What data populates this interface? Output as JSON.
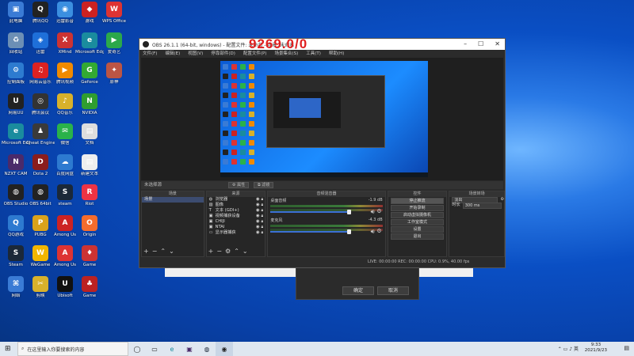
{
  "overlay_number": "9269.0/0",
  "desktop_icons": [
    {
      "label": "此电脑",
      "color": "#3a7bd5",
      "glyph": "▣"
    },
    {
      "label": "腾讯QQ",
      "color": "#222",
      "glyph": "Q"
    },
    {
      "label": "迅雷影音",
      "color": "#3b8fe0",
      "glyph": "◉"
    },
    {
      "label": "游戏",
      "color": "#c22",
      "glyph": "◆"
    },
    {
      "label": "WPS Office",
      "color": "#d33",
      "glyph": "W"
    },
    {
      "label": "回收站",
      "color": "#6c8fb5",
      "glyph": "♻"
    },
    {
      "label": "迅雷",
      "color": "#1e6fd9",
      "glyph": "◈"
    },
    {
      "label": "XMind",
      "color": "#c33",
      "glyph": "X"
    },
    {
      "label": "Microsoft Edge",
      "color": "#1a8c9e",
      "glyph": "e"
    },
    {
      "label": "爱奇艺",
      "color": "#2ba84a",
      "glyph": "▶"
    },
    {
      "label": "控制面板",
      "color": "#2d7bd0",
      "glyph": "⚙"
    },
    {
      "label": "网易云音乐",
      "color": "#d22",
      "glyph": "♫"
    },
    {
      "label": "腾讯视频",
      "color": "#f08a00",
      "glyph": "▶"
    },
    {
      "label": "Geforce",
      "color": "#3a3",
      "glyph": "G"
    },
    {
      "label": "原神",
      "color": "#b54",
      "glyph": "✦"
    },
    {
      "label": "网易UU",
      "color": "#222",
      "glyph": "U"
    },
    {
      "label": "腾讯会议",
      "color": "#333",
      "glyph": "◎"
    },
    {
      "label": "QQ音乐",
      "color": "#d8b12b",
      "glyph": "♪"
    },
    {
      "label": "NVIDIA",
      "color": "#2f9e2f",
      "glyph": "N"
    },
    {
      "label": "Microsoft Edge",
      "color": "#1a8c9e",
      "glyph": "e"
    },
    {
      "label": "Cheat Engine",
      "color": "#3a3a3a",
      "glyph": "♟"
    },
    {
      "label": "微信",
      "color": "#2ab24a",
      "glyph": "✉"
    },
    {
      "label": "文档",
      "color": "#ddd",
      "glyph": "▤"
    },
    {
      "label": "NZXT CAM",
      "color": "#4a2a6a",
      "glyph": "N"
    },
    {
      "label": "Dota 2",
      "color": "#8a1d1d",
      "glyph": "D"
    },
    {
      "label": "百度网盘",
      "color": "#2d7ad0",
      "glyph": "☁"
    },
    {
      "label": "新建文本",
      "color": "#eee",
      "glyph": "▤"
    },
    {
      "label": "OBS Studio",
      "color": "#222",
      "glyph": "◍"
    },
    {
      "label": "OBS 64bit",
      "color": "#222",
      "glyph": "◍"
    },
    {
      "label": "steam",
      "color": "#1b2838",
      "glyph": "S"
    },
    {
      "label": "Riot",
      "color": "#e34",
      "glyph": "R"
    },
    {
      "label": "QQ游戏",
      "color": "#2d7ad0",
      "glyph": "Q"
    },
    {
      "label": "PUBG",
      "color": "#d9a21b",
      "glyph": "P"
    },
    {
      "label": "Among Us",
      "color": "#c22",
      "glyph": "A"
    },
    {
      "label": "Origin",
      "color": "#f56c2d",
      "glyph": "O"
    },
    {
      "label": "Steam",
      "color": "#1b2838",
      "glyph": "S"
    },
    {
      "label": "WeGame",
      "color": "#f2b600",
      "glyph": "W"
    },
    {
      "label": "Among Us",
      "color": "#d33",
      "glyph": "A"
    },
    {
      "label": "Game",
      "color": "#c33",
      "glyph": "♦"
    },
    {
      "label": "网络",
      "color": "#3a7bd5",
      "glyph": "⌘"
    },
    {
      "label": "剪映",
      "color": "#d8b12b",
      "glyph": "✂"
    },
    {
      "label": "Ubisoft",
      "color": "#111",
      "glyph": "U"
    },
    {
      "label": "Game",
      "color": "#b22",
      "glyph": "♣"
    }
  ],
  "obs": {
    "title": "OBS 26.1.1 (64-bit, windows) - 配置文件: 未命名 - 场景: 未命名",
    "menus": [
      "文件(F)",
      "编辑(E)",
      "视图(V)",
      "停靠部件(D)",
      "配置文件(P)",
      "场景集合(S)",
      "工具(T)",
      "帮助(H)"
    ],
    "scene_bar_label": "未选择源",
    "scene_bar_buttons": [
      "属性",
      "滤镜"
    ],
    "scenes_header": "场景",
    "scenes": [
      "场景"
    ],
    "sources_header": "来源",
    "sources": [
      "浏览器",
      "图像",
      "文本 (GDI+)",
      "视频捕获设备",
      "CHIJI",
      "NTAI",
      "显示器捕获"
    ],
    "mixer_header": "音频混音器",
    "mixer": [
      {
        "name": "桌面音频",
        "db": "-1.9 dB"
      },
      {
        "name": "麦克风",
        "db": "-4.3 dB"
      }
    ],
    "controls_header": "控件",
    "controls": [
      "停止推流",
      "开始录制",
      "启动虚拟摄像机",
      "工作室模式",
      "设置",
      "退出"
    ],
    "transitions_header": "场景转场",
    "transition_type": "淡出",
    "duration_label": "时长",
    "duration_value": "300 ms",
    "status": "LIVE: 00:00:00   REC: 00:00:00   CPU: 0.9%, 40.00 fps"
  },
  "dialog": {
    "buttons": [
      "确定",
      "取消"
    ]
  },
  "taskbar": {
    "search_placeholder": "在这里输入你要搜索的内容",
    "time": "9:33",
    "date": "2021/9/23"
  }
}
